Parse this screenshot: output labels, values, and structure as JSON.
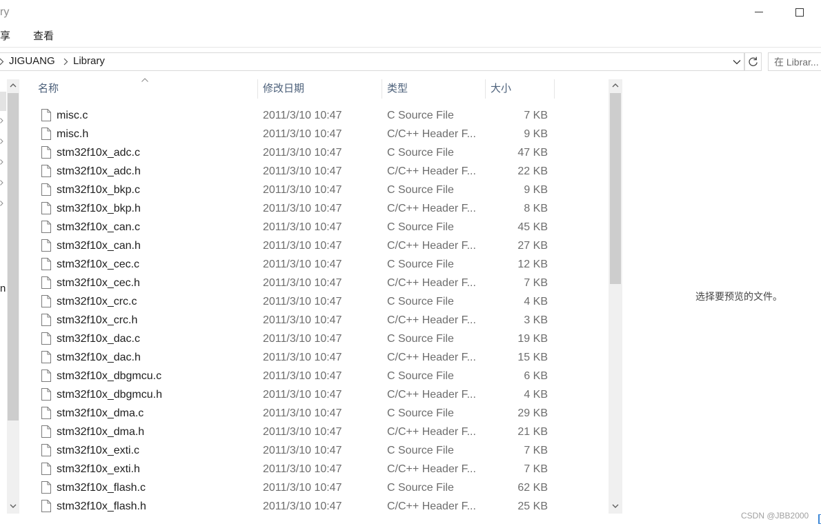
{
  "window": {
    "title": "ry"
  },
  "ribbon": {
    "tabs": [
      "享",
      "查看"
    ]
  },
  "address": {
    "path": [
      "JIGUANG",
      "Library"
    ],
    "search_placeholder": "在 Librar..."
  },
  "nav": {
    "partial_label": "n"
  },
  "columns": {
    "name": "名称",
    "modified": "修改日期",
    "type": "类型",
    "size": "大小"
  },
  "files": [
    {
      "name": "misc.c",
      "modified": "2011/3/10 10:47",
      "type": "C Source File",
      "size": "7 KB"
    },
    {
      "name": "misc.h",
      "modified": "2011/3/10 10:47",
      "type": "C/C++ Header F...",
      "size": "9 KB"
    },
    {
      "name": "stm32f10x_adc.c",
      "modified": "2011/3/10 10:47",
      "type": "C Source File",
      "size": "47 KB"
    },
    {
      "name": "stm32f10x_adc.h",
      "modified": "2011/3/10 10:47",
      "type": "C/C++ Header F...",
      "size": "22 KB"
    },
    {
      "name": "stm32f10x_bkp.c",
      "modified": "2011/3/10 10:47",
      "type": "C Source File",
      "size": "9 KB"
    },
    {
      "name": "stm32f10x_bkp.h",
      "modified": "2011/3/10 10:47",
      "type": "C/C++ Header F...",
      "size": "8 KB"
    },
    {
      "name": "stm32f10x_can.c",
      "modified": "2011/3/10 10:47",
      "type": "C Source File",
      "size": "45 KB"
    },
    {
      "name": "stm32f10x_can.h",
      "modified": "2011/3/10 10:47",
      "type": "C/C++ Header F...",
      "size": "27 KB"
    },
    {
      "name": "stm32f10x_cec.c",
      "modified": "2011/3/10 10:47",
      "type": "C Source File",
      "size": "12 KB"
    },
    {
      "name": "stm32f10x_cec.h",
      "modified": "2011/3/10 10:47",
      "type": "C/C++ Header F...",
      "size": "7 KB"
    },
    {
      "name": "stm32f10x_crc.c",
      "modified": "2011/3/10 10:47",
      "type": "C Source File",
      "size": "4 KB"
    },
    {
      "name": "stm32f10x_crc.h",
      "modified": "2011/3/10 10:47",
      "type": "C/C++ Header F...",
      "size": "3 KB"
    },
    {
      "name": "stm32f10x_dac.c",
      "modified": "2011/3/10 10:47",
      "type": "C Source File",
      "size": "19 KB"
    },
    {
      "name": "stm32f10x_dac.h",
      "modified": "2011/3/10 10:47",
      "type": "C/C++ Header F...",
      "size": "15 KB"
    },
    {
      "name": "stm32f10x_dbgmcu.c",
      "modified": "2011/3/10 10:47",
      "type": "C Source File",
      "size": "6 KB"
    },
    {
      "name": "stm32f10x_dbgmcu.h",
      "modified": "2011/3/10 10:47",
      "type": "C/C++ Header F...",
      "size": "4 KB"
    },
    {
      "name": "stm32f10x_dma.c",
      "modified": "2011/3/10 10:47",
      "type": "C Source File",
      "size": "29 KB"
    },
    {
      "name": "stm32f10x_dma.h",
      "modified": "2011/3/10 10:47",
      "type": "C/C++ Header F...",
      "size": "21 KB"
    },
    {
      "name": "stm32f10x_exti.c",
      "modified": "2011/3/10 10:47",
      "type": "C Source File",
      "size": "7 KB"
    },
    {
      "name": "stm32f10x_exti.h",
      "modified": "2011/3/10 10:47",
      "type": "C/C++ Header F...",
      "size": "7 KB"
    },
    {
      "name": "stm32f10x_flash.c",
      "modified": "2011/3/10 10:47",
      "type": "C Source File",
      "size": "62 KB"
    },
    {
      "name": "stm32f10x_flash.h",
      "modified": "2011/3/10 10:47",
      "type": "C/C++ Header F...",
      "size": "25 KB"
    }
  ],
  "preview": {
    "message": "选择要预览的文件。"
  },
  "watermark": "CSDN @JBB2000",
  "icons": {
    "file": "document-icon",
    "refresh": "refresh-icon",
    "sort": "sort-ascending-icon",
    "minimize": "minimize-icon",
    "maximize": "maximize-icon"
  },
  "colors": {
    "column_header_text": "#4c607a",
    "secondary_text": "#6d6d6d",
    "scrollbar_thumb": "#cdcdcd",
    "scrollbar_track": "#f0f0f0"
  }
}
